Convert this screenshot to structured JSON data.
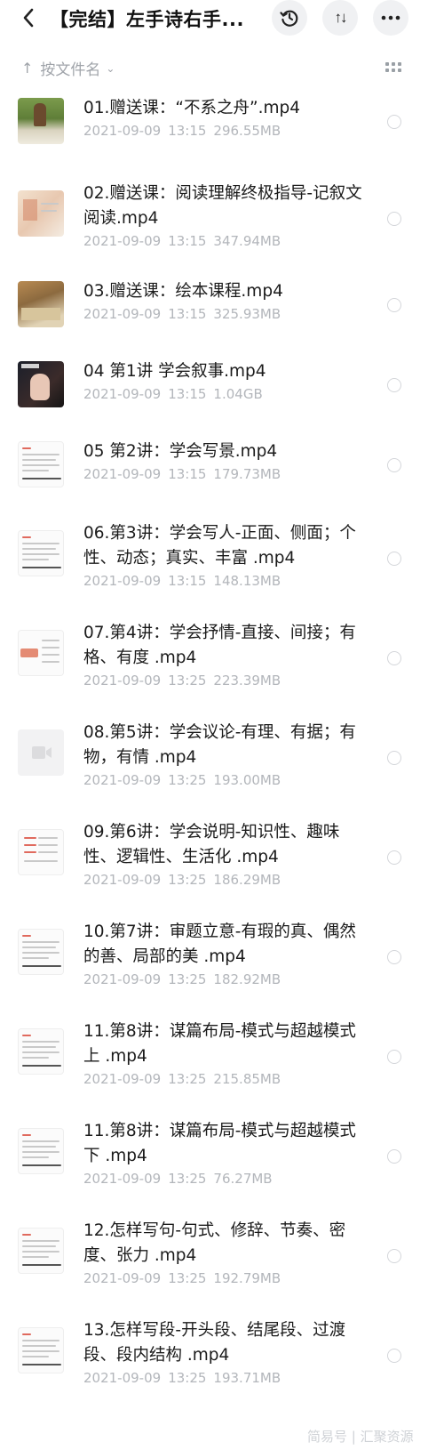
{
  "header": {
    "title": "【完结】左手诗右手...",
    "back_icon": "chevron-left-icon",
    "history_icon": "history-clock-icon",
    "sort_glyph": "↑↓",
    "more_icon": "more-horizontal-icon"
  },
  "toolbar": {
    "sort_label": "按文件名",
    "sort_arrow": "↑",
    "sort_chevron": "⌄",
    "view_icon": "grid-view-icon"
  },
  "files": [
    {
      "name": "01.赠送课：“不系之舟”.mp4",
      "date": "2021-09-09",
      "time": "13:15",
      "size": "296.55MB",
      "thumb": "painting"
    },
    {
      "name": "02.赠送课：阅读理解终极指导-记叙文阅读.mp4",
      "date": "2021-09-09",
      "time": "13:15",
      "size": "347.94MB",
      "thumb": "slide"
    },
    {
      "name": "03.赠送课：绘本课程.mp4",
      "date": "2021-09-09",
      "time": "13:15",
      "size": "325.93MB",
      "thumb": "picturebook"
    },
    {
      "name": "04 第1讲 学会叙事.mp4",
      "date": "2021-09-09",
      "time": "13:15",
      "size": "1.04GB",
      "thumb": "video"
    },
    {
      "name": "05 第2讲：学会写景.mp4",
      "date": "2021-09-09",
      "time": "13:15",
      "size": "179.73MB",
      "thumb": "doc"
    },
    {
      "name": "06.第3讲：学会写人-正面、侧面；个性、动态；真实、丰富 .mp4",
      "date": "2021-09-09",
      "time": "13:15",
      "size": "148.13MB",
      "thumb": "doc"
    },
    {
      "name": "07.第4讲：学会抒情-直接、间接；有格、有度 .mp4",
      "date": "2021-09-09",
      "time": "13:25",
      "size": "223.39MB",
      "thumb": "mindmap"
    },
    {
      "name": "08.第5讲：学会议论-有理、有据；有物，有情 .mp4",
      "date": "2021-09-09",
      "time": "13:25",
      "size": "193.00MB",
      "thumb": "placeholder"
    },
    {
      "name": "09.第6讲：学会说明-知识性、趣味性、逻辑性、生活化 .mp4",
      "date": "2021-09-09",
      "time": "13:25",
      "size": "186.29MB",
      "thumb": "doc-red"
    },
    {
      "name": "10.第7讲：审题立意-有瑕的真、偶然的善、局部的美 .mp4",
      "date": "2021-09-09",
      "time": "13:25",
      "size": "182.92MB",
      "thumb": "doc"
    },
    {
      "name": "11.第8讲：谋篇布局-模式与超越模式上 .mp4",
      "date": "2021-09-09",
      "time": "13:25",
      "size": "215.85MB",
      "thumb": "doc"
    },
    {
      "name": "11.第8讲：谋篇布局-模式与超越模式下 .mp4",
      "date": "2021-09-09",
      "time": "13:25",
      "size": "76.27MB",
      "thumb": "doc"
    },
    {
      "name": "12.怎样写句-句式、修辞、节奏、密度、张力 .mp4",
      "date": "2021-09-09",
      "time": "13:25",
      "size": "192.79MB",
      "thumb": "doc"
    },
    {
      "name": "13.怎样写段-开头段、结尾段、过渡段、段内结构 .mp4",
      "date": "2021-09-09",
      "time": "13:25",
      "size": "193.71MB",
      "thumb": "doc"
    }
  ],
  "watermark": "简易号 | 汇聚资源"
}
